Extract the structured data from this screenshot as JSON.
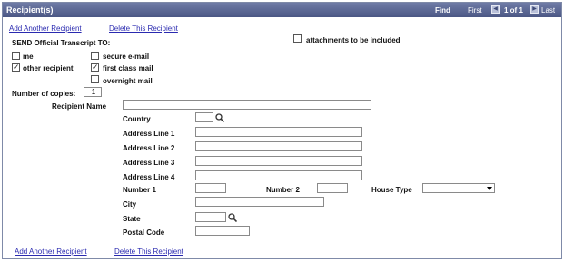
{
  "header": {
    "title": "Recipient(s)",
    "find": "Find",
    "first": "First",
    "pager": "1 of 1",
    "last": "Last"
  },
  "actions": {
    "add": "Add Another Recipient",
    "delete": "Delete This Recipient"
  },
  "send": {
    "heading": "SEND Official Transcript TO:",
    "attachments": {
      "label": "attachments to be included",
      "checked": false
    },
    "me": {
      "label": "me",
      "checked": false
    },
    "secure_email": {
      "label": "secure e-mail",
      "checked": false
    },
    "other_recipient": {
      "label": "other recipient",
      "checked": true
    },
    "first_class": {
      "label": "first class mail",
      "checked": true
    },
    "overnight": {
      "label": "overnight mail",
      "checked": false
    }
  },
  "copies": {
    "label": "Number of copies:",
    "value": "1"
  },
  "recipient_name": {
    "label": "Recipient Name",
    "value": ""
  },
  "address": {
    "country": "Country",
    "line1": "Address Line 1",
    "line2": "Address Line 2",
    "line3": "Address Line 3",
    "line4": "Address Line 4",
    "number1": "Number 1",
    "number2": "Number 2",
    "house_type": "House Type",
    "city": "City",
    "state": "State",
    "postal": "Postal Code"
  },
  "icons": {
    "search": "search-icon",
    "prev": "prev-arrow-icon",
    "next": "next-arrow-icon",
    "check": "check-icon"
  }
}
